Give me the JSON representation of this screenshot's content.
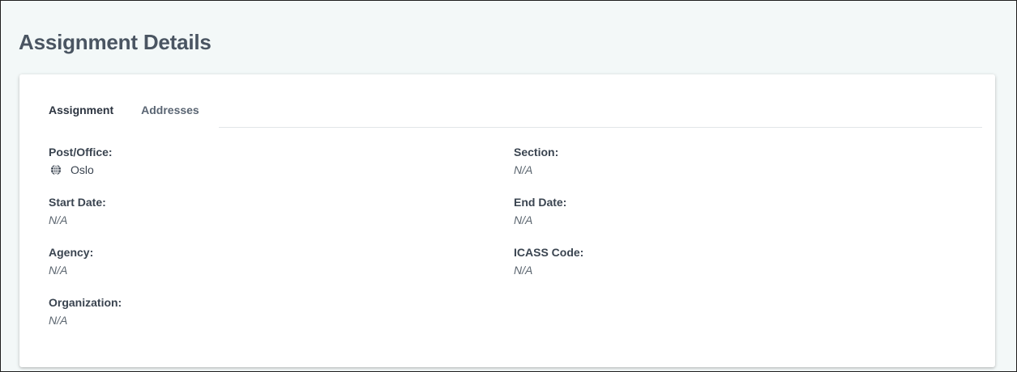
{
  "page": {
    "title": "Assignment Details"
  },
  "tabs": [
    {
      "label": "Assignment",
      "active": true
    },
    {
      "label": "Addresses",
      "active": false
    }
  ],
  "fields": {
    "post_office": {
      "label": "Post/Office:",
      "value": "Oslo",
      "icon": "globe-icon"
    },
    "section": {
      "label": "Section:",
      "value": "N/A"
    },
    "start_date": {
      "label": "Start Date:",
      "value": "N/A"
    },
    "end_date": {
      "label": "End Date:",
      "value": "N/A"
    },
    "agency": {
      "label": "Agency:",
      "value": "N/A"
    },
    "icass_code": {
      "label": "ICASS Code:",
      "value": "N/A"
    },
    "organization": {
      "label": "Organization:",
      "value": "N/A"
    }
  },
  "colors": {
    "page_background": "#f3f8f8",
    "card_background": "#ffffff",
    "title_text": "#4a5562",
    "label_text": "#3a4450",
    "value_text": "#5c6670"
  }
}
